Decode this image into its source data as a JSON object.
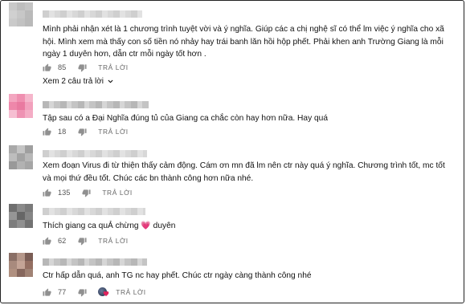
{
  "comments": [
    {
      "avatar_colors": [
        "#c9c9c9",
        "#bdbdbd",
        "#c4c4c4",
        "#d0d0d0",
        "#c7c7c7",
        "#bababa",
        "#cacaca",
        "#c2c2c2",
        "#b9b9b9"
      ],
      "text": "Mình phải nhận xét là 1 chương trình tuyệt vời và ý nghĩa. Giúp các a chị nghệ sĩ có thể lm việc ý nghĩa cho xã hội. Mình xem mà thấy con số tiền nó nhảy hay trái banh lăn hồi hộp phết. Phải khen anh Trường Giang là mỗi ngày 1 duyên hơn, dẫn ctr mỗi ngày tốt hơn .",
      "likes": "85",
      "reply_label": "TRẢ LỜI",
      "view_replies": "Xem 2 câu trả lời"
    },
    {
      "avatar_colors": [
        "#f3a6c0",
        "#ef8fb0",
        "#f5b6cb",
        "#ee87aa",
        "#e97aa0",
        "#f2a1bd",
        "#f6bfd2",
        "#ee93b3",
        "#f4adc5"
      ],
      "text": "Tập sau có a Đại Nghĩa đúng tủ của Giang ca chắc còn hay hơn nữa. Hay quá",
      "likes": "18",
      "reply_label": "TRẢ LỜI"
    },
    {
      "avatar_colors": [
        "#a9a9a9",
        "#c4c4c4",
        "#9f9f9f",
        "#bdbdbd",
        "#a3a3a3",
        "#b8b8b8",
        "#999999",
        "#b2b2b2",
        "#a6a6a6"
      ],
      "text": "Xem đoạn Virus đi từ thiện thấy cảm động. Cám ơn mn đã lm nên ctr này quá ý nghĩa. Chương trình tốt, mc tốt và mọi thứ đều tốt. Chúc các bn thành công hơn nữa nhé.",
      "likes": "135",
      "reply_label": "TRẢ LỜI"
    },
    {
      "avatar_colors": [
        "#6f6f6f",
        "#8a8a8a",
        "#7a7a7a",
        "#959595",
        "#666666",
        "#858585",
        "#7d7d7d",
        "#909090",
        "#727272"
      ],
      "text_before": "Thích giang ca quẢ chừng",
      "emoji": "💗",
      "text_after": "duyên",
      "likes": "62",
      "reply_label": "TRẢ LỜI"
    },
    {
      "avatar_colors": [
        "#8a6f66",
        "#b5978a",
        "#7a5d55",
        "#a88a7d",
        "#c4a496",
        "#946f62",
        "#b09080",
        "#86675d",
        "#a08274"
      ],
      "text": "Ctr hấp dẫn quá, anh TG nc hay phết. Chúc ctr ngày càng thành công nhé",
      "likes": "77",
      "reply_label": "TRẢ LỜI"
    }
  ],
  "colors": {
    "icon_gray": "#909090",
    "heart_red": "#e0245e"
  }
}
